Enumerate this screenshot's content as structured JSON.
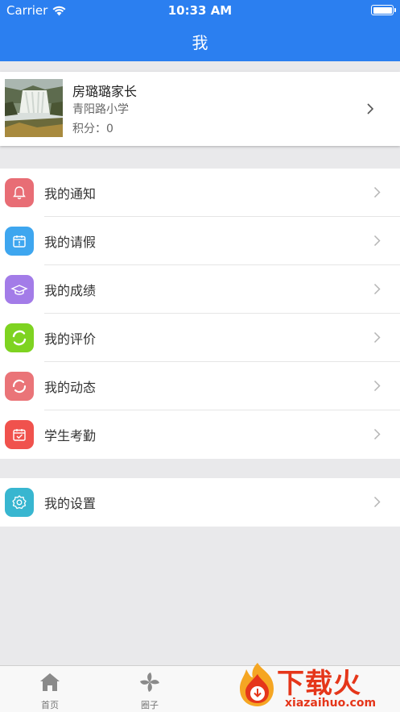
{
  "status_bar": {
    "carrier": "Carrier",
    "time": "10:33 AM"
  },
  "nav": {
    "title": "我"
  },
  "profile": {
    "name": "房璐璐家长",
    "school": "青阳路小学",
    "points": "积分：0"
  },
  "menu": [
    {
      "label": "我的通知",
      "icon": "bell-icon",
      "color": "#e86d75"
    },
    {
      "label": "我的请假",
      "icon": "calendar-icon",
      "color": "#3ea6ef"
    },
    {
      "label": "我的成绩",
      "icon": "graduation-cap-icon",
      "color": "#a37ce8"
    },
    {
      "label": "我的评价",
      "icon": "ring-icon",
      "color": "#7ed321"
    },
    {
      "label": "我的动态",
      "icon": "refresh-ring-icon",
      "color": "#ea7478"
    },
    {
      "label": "学生考勤",
      "icon": "calendar-check-icon",
      "color": "#f0524d"
    }
  ],
  "settings": {
    "label": "我的设置",
    "icon": "gear-icon",
    "color": "#38b6d0"
  },
  "tabbar": {
    "items": [
      {
        "label": "首页",
        "icon": "home-icon"
      },
      {
        "label": "圈子",
        "icon": "pinwheel-icon"
      }
    ]
  },
  "watermark": {
    "text": "下载火",
    "url": "xiazaihuo.com"
  },
  "colors": {
    "accent": "#2b7ff0",
    "background": "#e9e9eb"
  }
}
